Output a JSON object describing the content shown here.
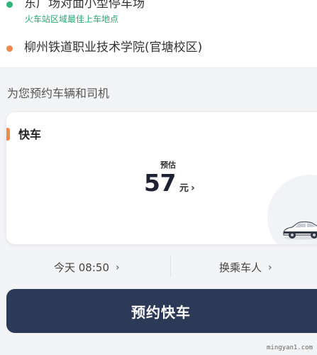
{
  "route": {
    "pickup": {
      "name": "东广场对面小型停车场",
      "hint": "火车站区域最佳上车地点"
    },
    "destination": {
      "name": "柳州铁道职业技术学院(官塘校区)"
    }
  },
  "section_title": "为您预约车辆和司机",
  "car_option": {
    "name": "快车",
    "estimate_label": "预估",
    "price": "57",
    "unit": "元",
    "chevron": "›"
  },
  "options": {
    "time_label": "今天 08:50",
    "rider_label": "换乘车人",
    "chevron": "›"
  },
  "book_button": "预约快车",
  "watermark": "mingyan1.com",
  "colors": {
    "pickup_dot": "#2fb67a",
    "destination_dot": "#ee8a4f",
    "hint_text": "#2aa874",
    "accent": "#ee8a4f",
    "primary_button": "#2d3a57"
  },
  "icons": {
    "pickup": "green-dot-icon",
    "destination": "orange-dot-icon",
    "car": "car-icon"
  }
}
